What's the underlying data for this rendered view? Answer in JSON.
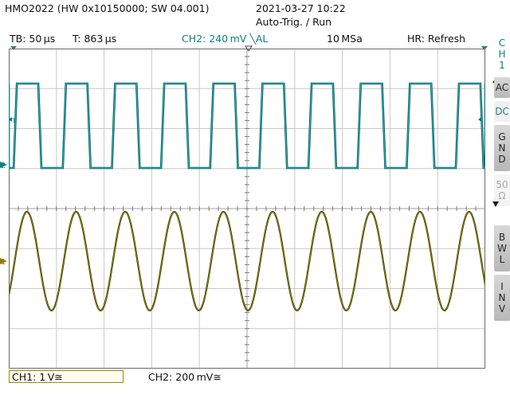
{
  "header": {
    "device": "HMO2022 (HW 0x10150000; SW 04.001)",
    "datetime": "2021-03-27 10:22",
    "trigger_status": "Auto-Trig. / Run"
  },
  "info_bar": {
    "timebase": "TB: 50 µs",
    "trigger_time": "T: 863 µs",
    "trigger_source": "CH2: 240 mV ╲AL",
    "sample_rate": "10 MSa",
    "hr_mode": "HR: Refresh"
  },
  "sidebar": {
    "channel": [
      "C",
      "H",
      "1"
    ],
    "coupling_ac": "AC",
    "coupling_dc": "DC",
    "gnd": [
      "G",
      "N",
      "D"
    ],
    "impedance": [
      "50",
      "Ω"
    ],
    "bwl": [
      "B",
      "W",
      "L"
    ],
    "inv": [
      "I",
      "N",
      "V"
    ]
  },
  "markers": {
    "ch2_ground": "2",
    "ch1_ground": "1",
    "trigger": "T"
  },
  "status_bar": {
    "ch1": "CH1: 1 V≅",
    "ch2": "CH2: 200 mV≅"
  },
  "colors": {
    "ch1_trace": "#8a8000",
    "ch1_trace_dark": "#3a3a00",
    "ch2_trace": "#20b8c0",
    "ch2_trace_dark": "#0d4a4a",
    "grid": "#c8c8c8",
    "grid_border": "#6a6a6a"
  },
  "waveforms": {
    "ch1": {
      "shape": "sine",
      "cycles_per_screen": 9.7
    },
    "ch2": {
      "shape": "square",
      "cycles_per_screen": 9.7
    }
  }
}
